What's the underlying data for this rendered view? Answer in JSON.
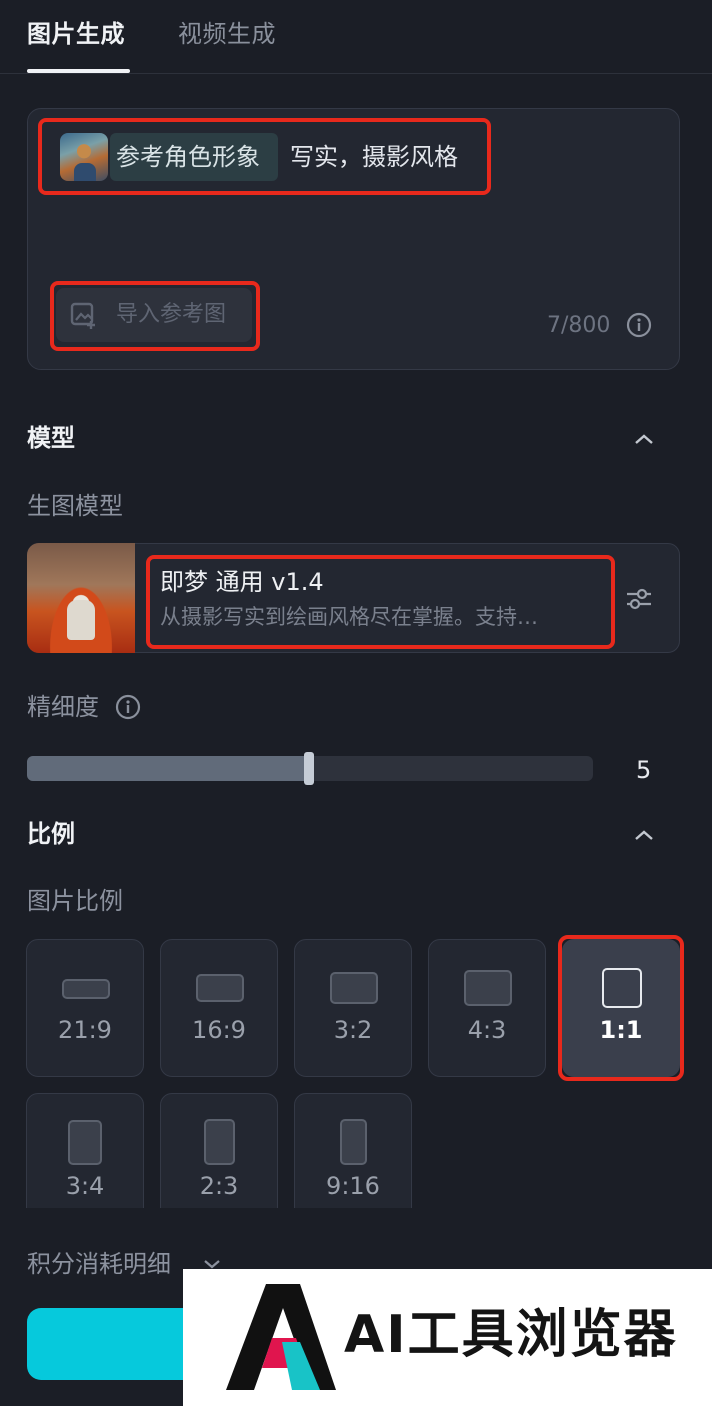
{
  "tabs": [
    {
      "label": "图片生成",
      "active": true
    },
    {
      "label": "视频生成",
      "active": false
    }
  ],
  "prompt": {
    "reference_chip": "参考角色形象",
    "text": "写实，摄影风格",
    "import_button": "导入参考图",
    "counter": "7/800"
  },
  "model_section": {
    "title": "模型",
    "sub_label": "生图模型",
    "model_name": "即梦 通用 v1.4",
    "model_desc": "从摄影写实到绘画风格尽在掌握。支持…"
  },
  "detail": {
    "label": "精细度",
    "value": "5",
    "level_fraction": 0.5
  },
  "ratio_section": {
    "title": "比例",
    "sub_label": "图片比例",
    "options": [
      "21:9",
      "16:9",
      "3:2",
      "4:3",
      "1:1",
      "3:4",
      "2:3",
      "9:16"
    ],
    "selected": "1:1"
  },
  "credits": {
    "label": "积分消耗明细"
  },
  "watermark": {
    "text": "AI工具浏览器"
  },
  "colors": {
    "background": "#1b1e26",
    "panel": "#232731",
    "accent": "#06c9dc",
    "highlight": "#e8291c"
  }
}
